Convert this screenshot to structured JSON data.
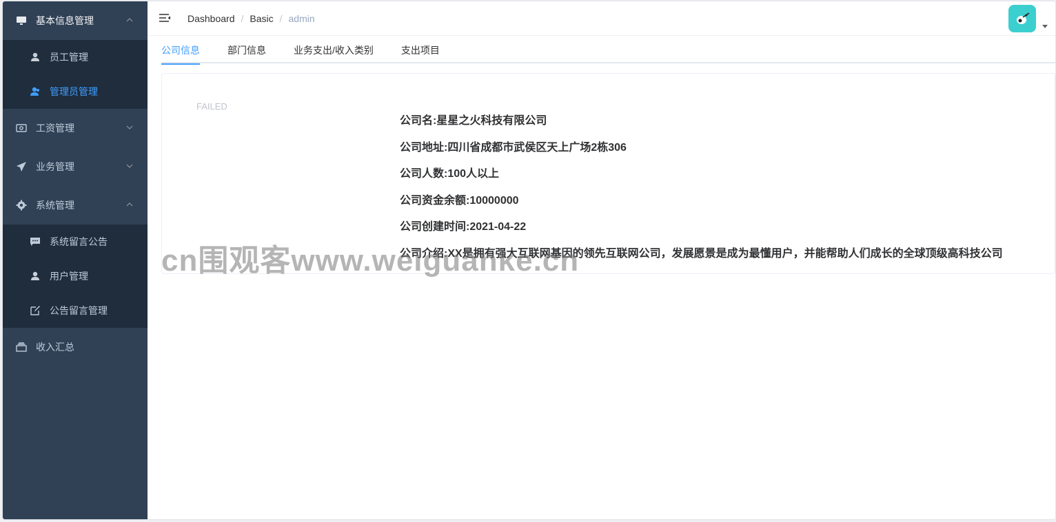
{
  "sidebar": {
    "groups": [
      {
        "label": "基本信息管理",
        "icon": "monitor-icon",
        "expanded": true,
        "items": [
          {
            "label": "员工管理",
            "icon": "user-icon",
            "active": false
          },
          {
            "label": "管理员管理",
            "icon": "user-icon",
            "active": true
          }
        ]
      },
      {
        "label": "工资管理",
        "icon": "money-icon",
        "expanded": false
      },
      {
        "label": "业务管理",
        "icon": "paper-plane-icon",
        "expanded": false
      },
      {
        "label": "系统管理",
        "icon": "gear-icon",
        "expanded": true,
        "items": [
          {
            "label": "系统留言公告",
            "icon": "message-icon"
          },
          {
            "label": "用户管理",
            "icon": "user-icon"
          },
          {
            "label": "公告留言管理",
            "icon": "edit-icon"
          }
        ]
      },
      {
        "label": "收入汇总",
        "icon": "box-icon"
      }
    ]
  },
  "navbar": {
    "breadcrumb": [
      "Dashboard",
      "Basic",
      "admin"
    ],
    "separator": "/"
  },
  "tabs": [
    "公司信息",
    "部门信息",
    "业务支出/收入类别",
    "支出项目"
  ],
  "card": {
    "image_failed_text": "FAILED",
    "lines": [
      "公司名:星星之火科技有限公司",
      "公司地址:四川省成都市武侯区天上广场2栋306",
      "公司人数:100人以上",
      "公司资金余额:10000000",
      "公司创建时间:2021-04-22",
      "公司介绍:XX是拥有强大互联网基因的领先互联网公司，发展愿景是成为最懂用户，并能帮助人们成长的全球顶级高科技公司"
    ]
  },
  "watermark": "cn围观客www.weiguanke.cn",
  "colors": {
    "sidebar_bg": "#304156",
    "submenu_bg": "#1f2d3d",
    "accent": "#409eff",
    "avatar_bg": "#3ccfcf"
  }
}
